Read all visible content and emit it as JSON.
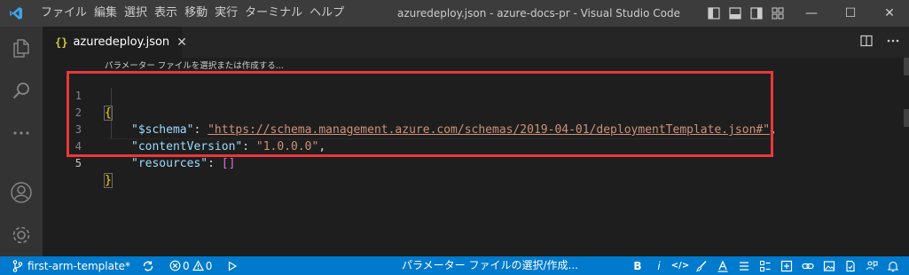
{
  "titlebar": {
    "menu": [
      "ファイル",
      "編集",
      "選択",
      "表示",
      "移動",
      "実行",
      "ターミナル",
      "ヘルプ"
    ],
    "window_title": "azuredeploy.json - azure-docs-pr - Visual Studio Code",
    "controls": {
      "minimize": "—",
      "maximize": "☐",
      "close": "✕"
    }
  },
  "tab": {
    "label": "azuredeploy.json",
    "close": "✕"
  },
  "editor": {
    "codelens": "パラメーター ファイルを選択または作成する...",
    "line_numbers": [
      "1",
      "2",
      "3",
      "4",
      "5"
    ],
    "lines": {
      "l1_open": "{",
      "l2_key": "\"$schema\"",
      "l2_colon": ": ",
      "l2_value": "\"https://schema.management.azure.com/schemas/2019-04-01/deploymentTemplate.json#\"",
      "l2_comma": ",",
      "l3_key": "\"contentVersion\"",
      "l3_colon": ": ",
      "l3_value": "\"1.0.0.0\"",
      "l3_comma": ",",
      "l4_key": "\"resources\"",
      "l4_colon": ": ",
      "l4_value": "[]",
      "l5_close": "}"
    }
  },
  "statusbar": {
    "branch": "first-arm-template*",
    "errors": "0",
    "warnings": "0",
    "center_text": "パラメーター ファイルの選択/作成...",
    "right_labels": {
      "bold": "B",
      "italic": "i",
      "code": "</>"
    }
  },
  "colors": {
    "accent": "#007acc",
    "highlight_box": "#e8383d",
    "editor_bg": "#1e1e1e"
  },
  "icons": [
    "vscode-logo-icon",
    "files-icon",
    "search-icon",
    "more-icon",
    "account-icon",
    "gear-icon",
    "split-editor-icon",
    "more-actions-icon",
    "branch-icon",
    "sync-icon",
    "error-icon",
    "warning-icon",
    "run-icon",
    "feedback-icon",
    "bell-icon"
  ]
}
